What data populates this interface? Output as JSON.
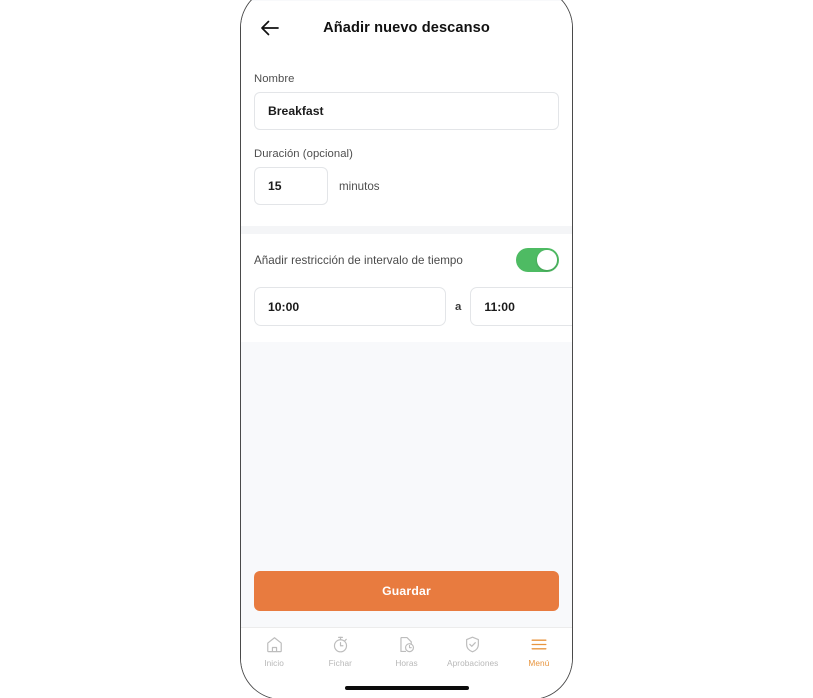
{
  "app": {
    "header": {
      "title": "Añadir nuevo descanso",
      "back_icon": "arrow-left-icon"
    }
  },
  "form": {
    "name_field": {
      "label": "Nombre",
      "value": "Breakfast",
      "placeholder": "Nombre"
    },
    "duration_field": {
      "label": "Duración (opcional)",
      "value": "15",
      "placeholder": "0",
      "unit": "minutos"
    },
    "time_restriction": {
      "label": "Añadir restricción de intervalo de tiempo",
      "enabled": true,
      "toggle_color": "#4ebb63",
      "start_time": "10:00",
      "separator": "a",
      "end_time": "11:00",
      "start_placeholder": "--:--",
      "end_placeholder": "--:--"
    }
  },
  "actions": {
    "save_label": "Guardar",
    "save_color": "#e87b3f"
  },
  "bottom_nav": {
    "active_color": "#e8953f",
    "inactive_color": "#b8b8b8",
    "items": [
      {
        "label": "Inicio",
        "icon": "home-icon",
        "active": false
      },
      {
        "label": "Fichar",
        "icon": "stopwatch-icon",
        "active": false
      },
      {
        "label": "Horas",
        "icon": "document-clock-icon",
        "active": false
      },
      {
        "label": "Aprobaciones",
        "icon": "shield-check-icon",
        "active": false
      },
      {
        "label": "Menú",
        "icon": "hamburger-menu-icon",
        "active": true
      }
    ]
  }
}
